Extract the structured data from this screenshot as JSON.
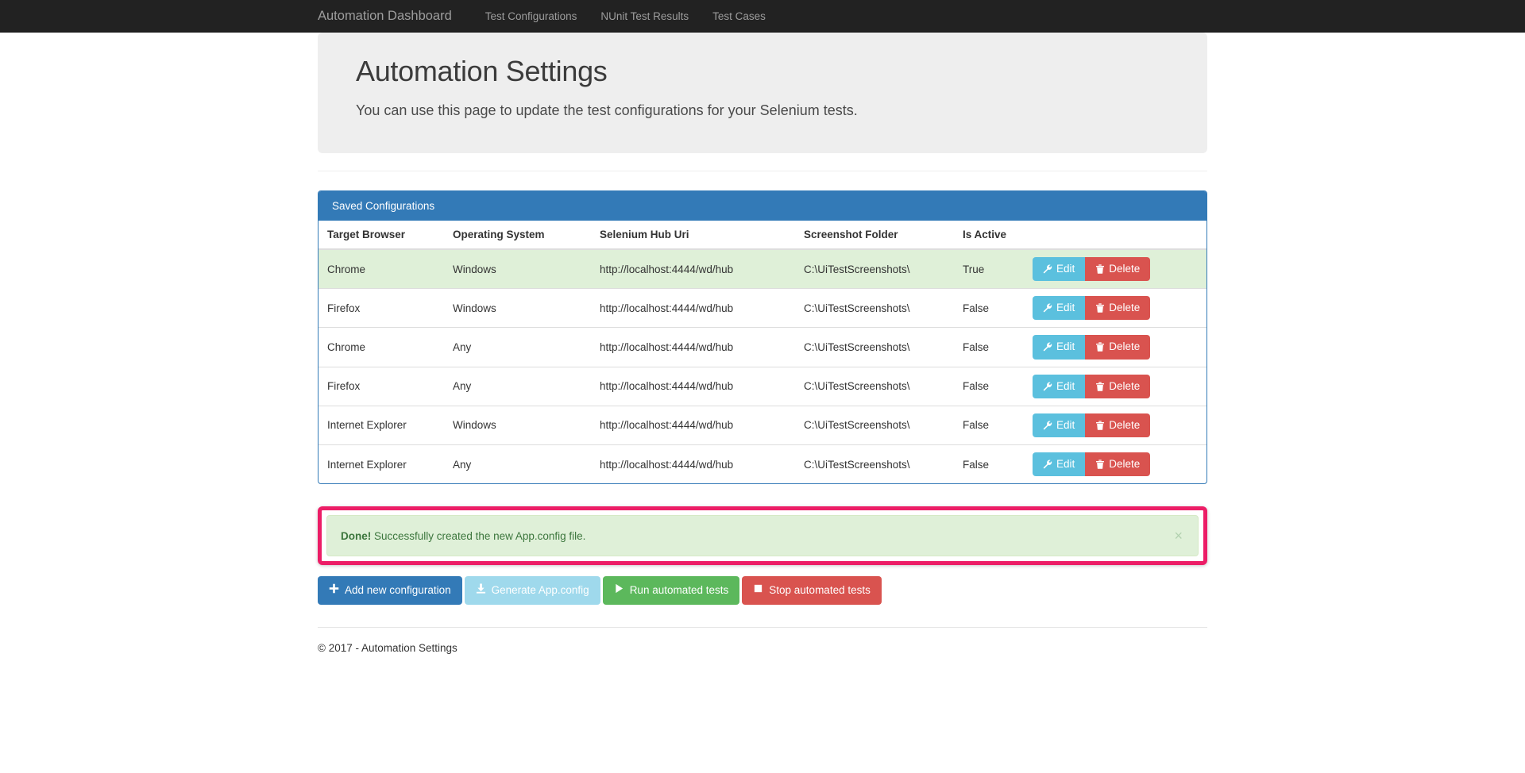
{
  "navbar": {
    "brand": "Automation Dashboard",
    "links": [
      {
        "label": "Test Configurations"
      },
      {
        "label": "NUnit Test Results"
      },
      {
        "label": "Test Cases"
      }
    ]
  },
  "hero": {
    "title": "Automation Settings",
    "subtitle": "You can use this page to update the test configurations for your Selenium tests."
  },
  "panel": {
    "heading": "Saved Configurations",
    "columns": [
      "Target Browser",
      "Operating System",
      "Selenium Hub Uri",
      "Screenshot Folder",
      "Is Active"
    ],
    "row_actions": {
      "edit_label": "Edit",
      "delete_label": "Delete"
    },
    "rows": [
      {
        "browser": "Chrome",
        "os": "Windows",
        "uri": "http://localhost:4444/wd/hub",
        "folder": "C:\\UiTestScreenshots\\",
        "active": "True",
        "highlighted": true
      },
      {
        "browser": "Firefox",
        "os": "Windows",
        "uri": "http://localhost:4444/wd/hub",
        "folder": "C:\\UiTestScreenshots\\",
        "active": "False",
        "highlighted": false
      },
      {
        "browser": "Chrome",
        "os": "Any",
        "uri": "http://localhost:4444/wd/hub",
        "folder": "C:\\UiTestScreenshots\\",
        "active": "False",
        "highlighted": false
      },
      {
        "browser": "Firefox",
        "os": "Any",
        "uri": "http://localhost:4444/wd/hub",
        "folder": "C:\\UiTestScreenshots\\",
        "active": "False",
        "highlighted": false
      },
      {
        "browser": "Internet Explorer",
        "os": "Windows",
        "uri": "http://localhost:4444/wd/hub",
        "folder": "C:\\UiTestScreenshots\\",
        "active": "False",
        "highlighted": false
      },
      {
        "browser": "Internet Explorer",
        "os": "Any",
        "uri": "http://localhost:4444/wd/hub",
        "folder": "C:\\UiTestScreenshots\\",
        "active": "False",
        "highlighted": false
      }
    ]
  },
  "alert": {
    "strong": "Done!",
    "message": "Successfully created the new App.config file.",
    "close_label": "×",
    "highlight_color": "#ec1d66",
    "background_color": "#dff0d8",
    "text_color": "#3c763d"
  },
  "actions": [
    {
      "label": "Add new configuration",
      "icon": "plus-icon",
      "style": "abtn-primary"
    },
    {
      "label": "Generate App.config",
      "icon": "download-icon",
      "style": "abtn-info"
    },
    {
      "label": "Run automated tests",
      "icon": "play-icon",
      "style": "abtn-success"
    },
    {
      "label": "Stop automated tests",
      "icon": "stop-icon",
      "style": "abtn-danger"
    }
  ],
  "footer": {
    "text": "© 2017 - Automation Settings"
  },
  "colors": {
    "navbar": "#222222",
    "panel_header": "#337ab7",
    "edit_button": "#5bc0de",
    "delete_button": "#d9534f",
    "active_row": "#dff0d8"
  }
}
